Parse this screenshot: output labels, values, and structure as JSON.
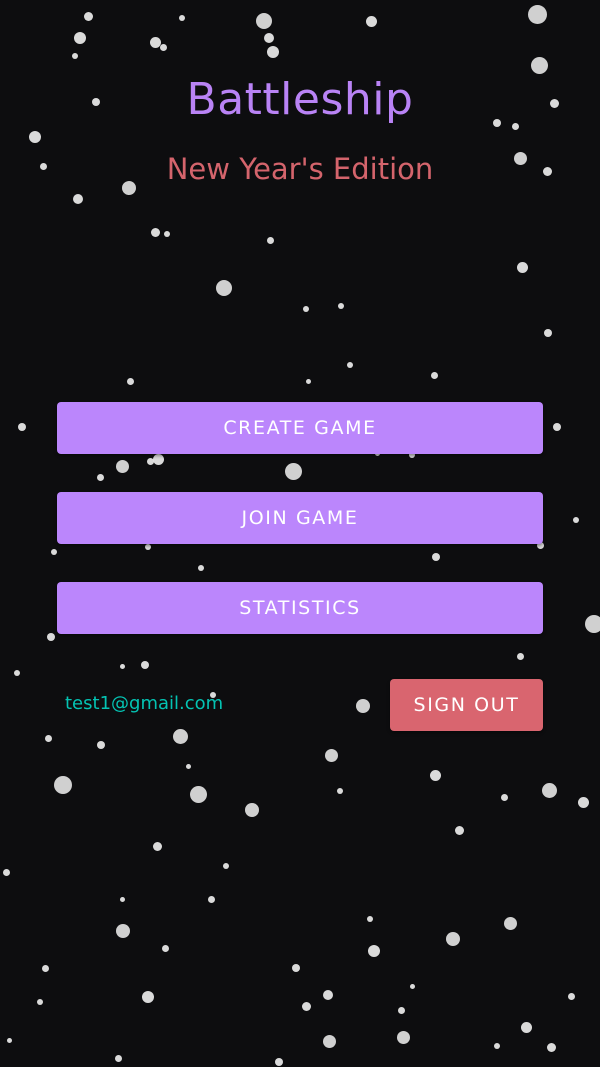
{
  "app": {
    "title": "Battleship",
    "subtitle": "New Year's Edition"
  },
  "menu": {
    "create_game_label": "CREATE GAME",
    "join_game_label": "JOIN GAME",
    "statistics_label": "STATISTICS"
  },
  "account": {
    "email": "test1@gmail.com",
    "sign_out_label": "SIGN OUT"
  },
  "colors": {
    "background": "#0d0d0f",
    "title": "#b983f5",
    "subtitle": "#d4646c",
    "primary_button": "#bb86fc",
    "sign_out_button": "#d9656f",
    "email_text": "#04c3b3",
    "snow": "#e6e6e6"
  }
}
